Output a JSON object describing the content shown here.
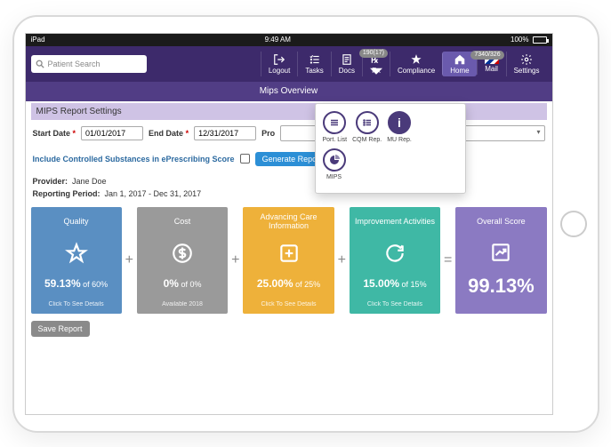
{
  "status": {
    "carrier": "iPad",
    "time": "9:49 AM",
    "battery": "100%"
  },
  "search": {
    "placeholder": "Patient Search"
  },
  "nav": {
    "logout": "Logout",
    "tasks": "Tasks",
    "docs": "Docs",
    "rx": "Rx",
    "rx_badge": "190(17)",
    "compliance": "Compliance",
    "home": "Home",
    "mail": "Mail",
    "mail_badge": "7340/326",
    "settings": "Settings"
  },
  "subheader": "Mips Overview",
  "flyout": {
    "port": "Port. List",
    "cqm": "CQM Rep.",
    "mu": "MU Rep.",
    "mips": "MIPS"
  },
  "panel": {
    "title": "MIPS Report Settings"
  },
  "form": {
    "start_label": "Start Date",
    "start_value": "01/01/2017",
    "end_label": "End Date",
    "end_value": "12/31/2017",
    "provider_label": "Pro",
    "controlled_label": "Include Controlled Substances in ePrescribing Score",
    "generate": "Generate Report"
  },
  "meta": {
    "provider_label": "Provider:",
    "provider_value": "Jane Doe",
    "period_label": "Reporting Period:",
    "period_value": "Jan 1, 2017 - Dec 31, 2017"
  },
  "cards": {
    "quality": {
      "title": "Quality",
      "value": "59.13%",
      "of": " of 60%",
      "sub": "Click To See Details"
    },
    "cost": {
      "title": "Cost",
      "value": "0%",
      "of": " of 0%",
      "sub": "Available 2018"
    },
    "aci": {
      "title": "Advancing Care Information",
      "value": "25.00%",
      "of": " of 25%",
      "sub": "Click To See Details"
    },
    "ia": {
      "title": "Improvement Activities",
      "value": "15.00%",
      "of": " of 15%",
      "sub": "Click To See Details"
    },
    "overall": {
      "title": "Overall Score",
      "value": "99.13%"
    }
  },
  "save": "Save Report",
  "colors": {
    "quality": "#5a8fc2",
    "cost": "#9a9a9a",
    "aci": "#eeb13a",
    "ia": "#3fb8a5",
    "overall": "#8b7ac2"
  }
}
